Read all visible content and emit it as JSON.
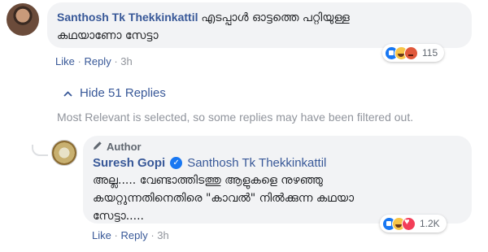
{
  "comment": {
    "author": "Santhosh Tk Thekkinkattil",
    "text_line1": "എടപ്പാൾ ഓട്ടത്തെ പറ്റിയുള്ള",
    "text_line2": "കഥയാണോ സേട്ടാ",
    "actions": {
      "like": "Like",
      "reply": "Reply",
      "sep": "·",
      "time": "3h"
    },
    "reactions": {
      "icons": [
        "like-icon",
        "haha-icon",
        "angry-icon"
      ],
      "count": "115"
    }
  },
  "replies_toggle": {
    "label": "Hide 51 Replies",
    "icon": "chevron-up-icon"
  },
  "filter_notice": "Most Relevant is selected, so some replies may have been filtered out.",
  "reply": {
    "badge": "Author",
    "author": "Suresh Gopi",
    "verified": "✓",
    "mention": "Santhosh Tk Thekkinkattil",
    "text_line1": "അല്ല..... വേണ്ടാത്തിടത്തു ആളുകളെ നുഴഞ്ഞു",
    "text_line2": "കയറ്റുന്നതിനെതിരെ \"കാവൽ\" നിൽക്കുന്ന കഥയാ",
    "text_line3": "സേട്ടാ.....",
    "actions": {
      "like": "Like",
      "reply": "Reply",
      "sep": "·",
      "time": "3h"
    },
    "reactions": {
      "icons": [
        "like-icon",
        "haha-icon",
        "love-icon"
      ],
      "count": "1.2K"
    }
  },
  "colors": {
    "link": "#385898",
    "bubble": "#f2f3f5",
    "muted": "#90949c",
    "like": "#1877f2"
  }
}
